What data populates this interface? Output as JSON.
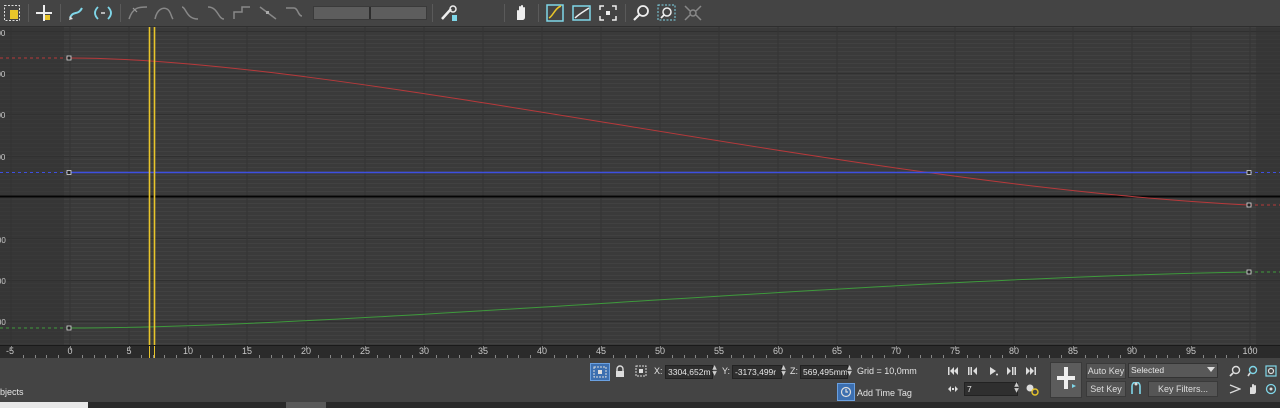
{
  "toolbar": {
    "icons": [
      "filter-icon",
      "move-keys-icon",
      "slide-keys-icon",
      "scale-keys-icon",
      "draw-curves-icon",
      "reduce-keys-icon",
      "tangent-auto-icon",
      "tangent-spline-icon",
      "tangent-fast-icon",
      "tangent-slow-icon",
      "tangent-step-icon",
      "tangent-linear-icon",
      "tangent-smooth-icon",
      "key-display-icon",
      "pan-icon",
      "frame-horizontal-icon",
      "frame-value-icon",
      "zoom-extents-icon",
      "zoom-icon",
      "zoom-region-icon",
      "isolate-curve-icon"
    ]
  },
  "ruler": {
    "labels": [
      "-5",
      "0",
      "5",
      "10",
      "15",
      "20",
      "25",
      "30",
      "35",
      "40",
      "45",
      "50",
      "55",
      "60",
      "65",
      "70",
      "75",
      "80",
      "85",
      "90",
      "95",
      "100"
    ]
  },
  "curves": {
    "colors": {
      "x": "#b8393b",
      "y": "#3e9a3c",
      "z": "#3d4fe0",
      "playhead": "#e8c52a",
      "background": "#3a3a3a"
    }
  },
  "status": {
    "selection_text": "bjects",
    "x_label": "X:",
    "x_value": "3304,652m",
    "y_label": "Y:",
    "y_value": "-3173,499r",
    "z_label": "Z:",
    "z_value": "569,495mm",
    "grid": "Grid = 10,0mm",
    "add_time_tag": "Add Time Tag",
    "frame_value": "7",
    "auto_key": "Auto Key",
    "set_key": "Set Key",
    "selected": "Selected",
    "key_filters": "Key Filters..."
  }
}
